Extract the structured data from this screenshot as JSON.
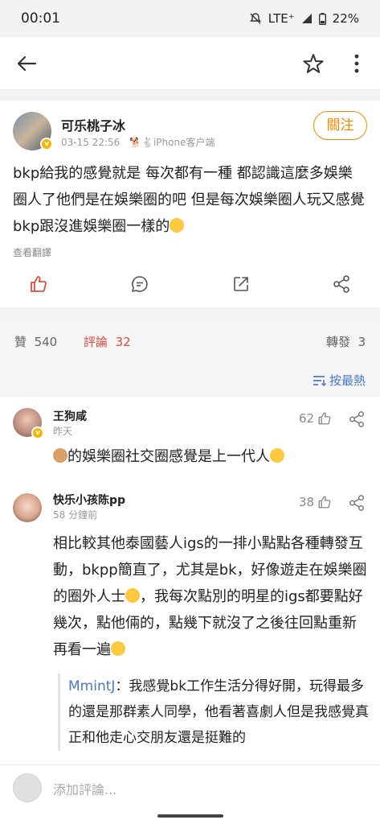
{
  "status_bar": {
    "time": "00:01",
    "network": "LTE⁺",
    "battery": "22%"
  },
  "post": {
    "author": "可乐桃子冰",
    "time": "03-15 22:56",
    "source": "🐕🐇iPhone客户端",
    "follow_label": "關注",
    "text": "bkp給我的感覺就是 每次都有一種 都認識這麼多娛樂圈人了他們是在娛樂圈的吧 但是每次娛樂圈人玩又感覺bkp跟沒進娛樂圈一樣的",
    "translate_label": "查看翻譯"
  },
  "tabs": {
    "likes_label": "贊",
    "likes_count": "540",
    "comments_label": "評論",
    "comments_count": "32",
    "reposts_label": "轉發",
    "reposts_count": "3"
  },
  "sort_label": "按最熱",
  "comments": [
    {
      "name": "王狗咸",
      "time": "昨天",
      "likes": "62",
      "text": "的娛樂圈社交圈感覺是上一代人"
    },
    {
      "name": "快乐小孩陈pp",
      "time": "58 分鐘前",
      "likes": "38",
      "text_1": "相比較其他泰國藝人igs的一排小點點各種轉發互動，bkpp簡直了，尤其是bk，好像遊走在娛樂圈的圈外人士",
      "text_2": "，我每次點別的明星的igs都要點好幾次，點他倆的，點幾下就沒了之後往回點重新再看一遍",
      "reply_name": "MmintJ",
      "reply_text": "：我感覺bk工作生活分得好開，玩得最多的還是那群素人同學，他看著喜劇人但是我感覺真正和他走心交朋友還是挺難的"
    }
  ],
  "comment_input_placeholder": "添加評論..."
}
